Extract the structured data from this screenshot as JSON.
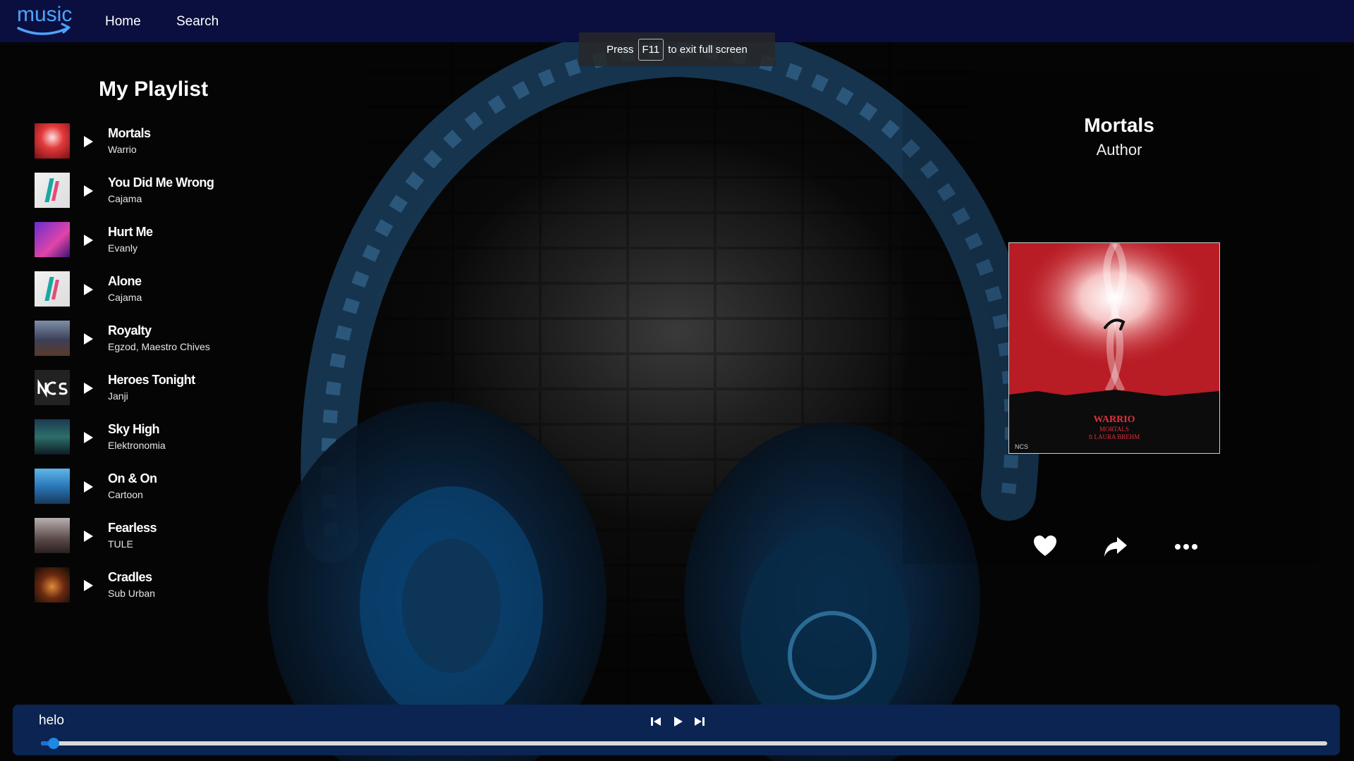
{
  "nav": {
    "logo_text": "music",
    "home_label": "Home",
    "search_label": "Search"
  },
  "fullscreen_notice": {
    "prefix": "Press",
    "key": "F11",
    "suffix": "to exit full screen"
  },
  "playlist": {
    "title": "My Playlist",
    "tracks": [
      {
        "name": "Mortals",
        "artist": "Warrio"
      },
      {
        "name": "You Did Me Wrong",
        "artist": "Cajama"
      },
      {
        "name": "Hurt Me",
        "artist": "Evanly"
      },
      {
        "name": "Alone",
        "artist": "Cajama"
      },
      {
        "name": "Royalty",
        "artist": "Egzod, Maestro Chives"
      },
      {
        "name": "Heroes Tonight",
        "artist": "Janji"
      },
      {
        "name": "Sky High",
        "artist": "Elektronomia"
      },
      {
        "name": "On & On",
        "artist": "Cartoon"
      },
      {
        "name": "Fearless",
        "artist": "TULE"
      },
      {
        "name": "Cradles",
        "artist": "Sub Urban"
      }
    ]
  },
  "now_playing": {
    "title": "Mortals",
    "author": "Author",
    "cover_text": {
      "artist": "WARRIO",
      "title": "MORTALS",
      "feat": "ft LAURA BREHM",
      "label": "NCS"
    }
  },
  "player": {
    "track_name": "helo",
    "progress": 0.01
  },
  "colors": {
    "navbar": "#0a0f3f",
    "player_bar": "#0b2452",
    "accent": "#1e88e5",
    "logo": "#4fa3ff"
  }
}
